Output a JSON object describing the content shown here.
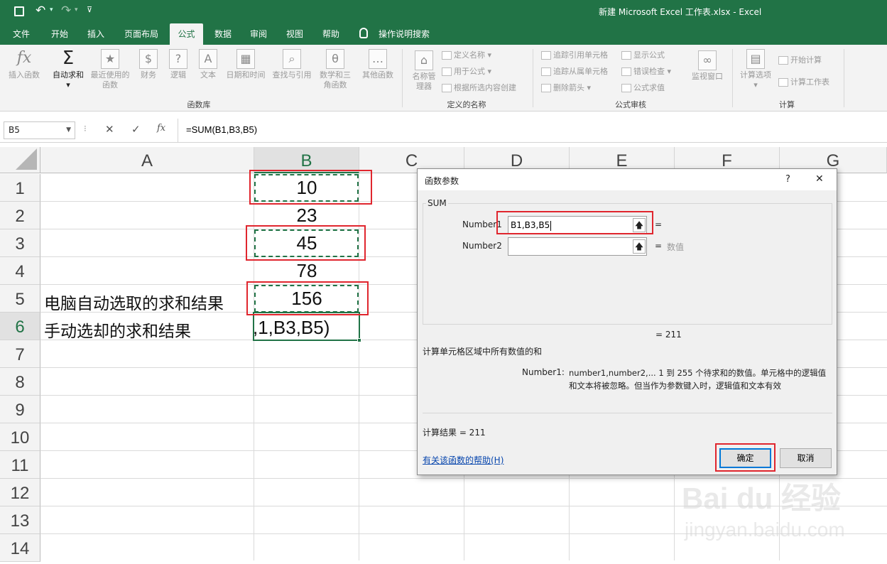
{
  "window": {
    "title": "新建 Microsoft Excel 工作表.xlsx  -  Excel",
    "qat": [
      "save-icon",
      "undo-icon",
      "redo-icon",
      "customize-icon"
    ]
  },
  "menu": {
    "tabs": [
      "文件",
      "开始",
      "插入",
      "页面布局",
      "公式",
      "数据",
      "审阅",
      "视图",
      "帮助"
    ],
    "active": "公式",
    "tell_me": "操作说明搜索"
  },
  "ribbon": {
    "func_lib": {
      "insert_fn": "插入函数",
      "insert_fn_icon": "fx",
      "autosum": "自动求和",
      "autosum_icon": "Σ",
      "recent": "最近使用的函数",
      "financial": "财务",
      "logical": "逻辑",
      "text": "文本",
      "datetime": "日期和时间",
      "lookup": "查找与引用",
      "math": "数学和三角函数",
      "more": "其他函数",
      "group": "函数库"
    },
    "names": {
      "manager": "名称管理器",
      "define": "定义名称",
      "use": "用于公式",
      "create": "根据所选内容创建",
      "group": "定义的名称"
    },
    "audit": {
      "trace_prec": "追踪引用单元格",
      "trace_dep": "追踪从属单元格",
      "remove": "删除箭头",
      "show": "显示公式",
      "check": "错误检查",
      "eval": "公式求值",
      "watch": "监视窗口",
      "group": "公式审核"
    },
    "calc": {
      "options": "计算选项",
      "calc_now": "开始计算",
      "calc_sheet": "计算工作表",
      "group": "计算"
    }
  },
  "formula_bar": {
    "namebox": "B5",
    "formula": "=SUM(B1,B3,B5)",
    "fx": "fx"
  },
  "sheet": {
    "columns": [
      "A",
      "B",
      "C",
      "D",
      "E",
      "F",
      "G"
    ],
    "selected_col": "B",
    "rows": [
      "1",
      "2",
      "3",
      "4",
      "5",
      "6",
      "7",
      "8",
      "9",
      "10",
      "11",
      "12",
      "13",
      "14"
    ],
    "selected_row": "6",
    "b_values": [
      "10",
      "23",
      "45",
      "78",
      "156",
      ",1,B3,B5)"
    ],
    "a5": "电脑自动选取的求和结果",
    "a6": "手动选却的求和结果"
  },
  "dialog": {
    "title": "函数参数",
    "help": "?",
    "close": "✕",
    "func": "SUM",
    "arg1_label": "Number1",
    "arg1_value": "B1,B3,B5",
    "arg1_eq": "=",
    "arg2_label": "Number2",
    "arg2_value": "",
    "arg2_eq": "=",
    "arg2_hint": "数值",
    "eq_result": "=   211",
    "description": "计算单元格区域中所有数值的和",
    "arg_desc_label": "Number1:",
    "arg_desc_line1": "number1,number2,...  1 到 255 个待求和的数值。单元格中的逻辑值",
    "arg_desc_line2": "和文本将被忽略。但当作为参数键入时，逻辑值和文本有效",
    "result_label": "计算结果 =   211",
    "help_link": "有关该函数的帮助(H)",
    "ok": "确定",
    "cancel": "取消"
  },
  "watermark": {
    "brand": "Bai du 经验",
    "url": "jingyan.baidu.com"
  }
}
